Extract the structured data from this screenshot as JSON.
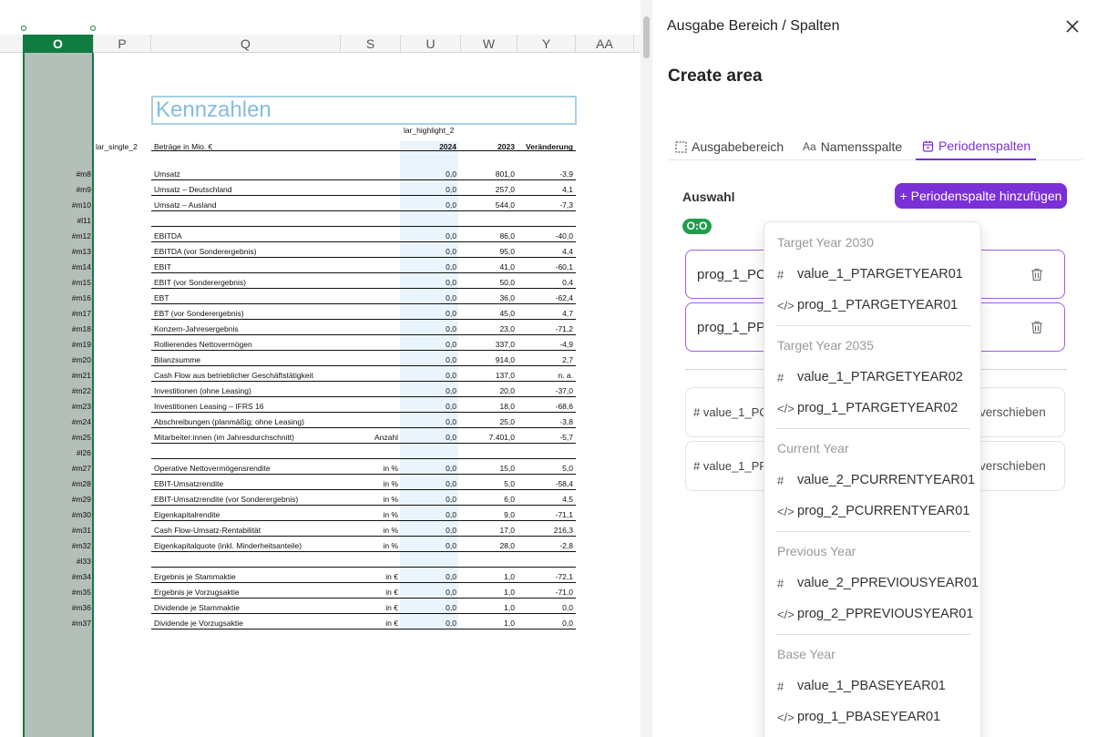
{
  "sheet": {
    "columns": [
      {
        "label": "O",
        "selected": true
      },
      {
        "label": "P"
      },
      {
        "label": "Q"
      },
      {
        "label": "S"
      },
      {
        "label": "U"
      },
      {
        "label": "W"
      },
      {
        "label": "Y"
      },
      {
        "label": "AA"
      }
    ],
    "title": "Kennzahlen",
    "highlight_label": "lar_highlight_2",
    "single_label": "lar_single_2",
    "amounts_label": "Beträge in Mio. €",
    "col_2024": "2024",
    "col_2023": "2023",
    "col_change": "Veränderung",
    "rows": [
      {
        "code": "#m8",
        "label": "Umsatz",
        "unit": "",
        "v2024": "0,0",
        "v2023": "801,0",
        "change": "-3,9"
      },
      {
        "code": "#m9",
        "label": "Umsatz – Deutschland",
        "unit": "",
        "v2024": "0,0",
        "v2023": "257,0",
        "change": "4,1"
      },
      {
        "code": "#m10",
        "label": "Umsatz – Ausland",
        "unit": "",
        "v2024": "0,0",
        "v2023": "544,0",
        "change": "-7,3"
      },
      {
        "code": "#l11",
        "label": "",
        "unit": "",
        "v2024": "",
        "v2023": "",
        "change": ""
      },
      {
        "code": "#m12",
        "label": "EBITDA",
        "unit": "",
        "v2024": "0,0",
        "v2023": "86,0",
        "change": "-40,0"
      },
      {
        "code": "#m13",
        "label": "EBITDA (vor Sonderergebnis)",
        "unit": "",
        "v2024": "0,0",
        "v2023": "95,0",
        "change": "4,4"
      },
      {
        "code": "#m14",
        "label": "EBIT",
        "unit": "",
        "v2024": "0,0",
        "v2023": "41,0",
        "change": "-60,1"
      },
      {
        "code": "#m15",
        "label": "EBIT (vor Sonderergebnis)",
        "unit": "",
        "v2024": "0,0",
        "v2023": "50,0",
        "change": "0,4"
      },
      {
        "code": "#m16",
        "label": "EBT",
        "unit": "",
        "v2024": "0,0",
        "v2023": "36,0",
        "change": "-62,4"
      },
      {
        "code": "#m17",
        "label": "EBT (vor Sonderergebnis)",
        "unit": "",
        "v2024": "0,0",
        "v2023": "45,0",
        "change": "4,7"
      },
      {
        "code": "#m18",
        "label": "Konzern-Jahresergebnis",
        "unit": "",
        "v2024": "0,0",
        "v2023": "23,0",
        "change": "-71,2"
      },
      {
        "code": "#m19",
        "label": "Rollierendes Nettovermögen",
        "unit": "",
        "v2024": "0,0",
        "v2023": "337,0",
        "change": "-4,9"
      },
      {
        "code": "#m20",
        "label": "Bilanzsumme",
        "unit": "",
        "v2024": "0,0",
        "v2023": "914,0",
        "change": "2,7"
      },
      {
        "code": "#m21",
        "label": "Cash Flow aus betrieblicher Geschäftstätigkeit",
        "unit": "",
        "v2024": "0,0",
        "v2023": "137,0",
        "change": "n. a."
      },
      {
        "code": "#m22",
        "label": "Investitionen (ohne Leasing)",
        "unit": "",
        "v2024": "0,0",
        "v2023": "20,0",
        "change": "-37,0"
      },
      {
        "code": "#m23",
        "label": "Investitionen Leasing – IFRS 16",
        "unit": "",
        "v2024": "0,0",
        "v2023": "18,0",
        "change": "-68,6"
      },
      {
        "code": "#m24",
        "label": "Abschreibungen (planmäßig; ohne Leasing)",
        "unit": "",
        "v2024": "0,0",
        "v2023": "25,0",
        "change": "-3,8"
      },
      {
        "code": "#m25",
        "label": "Mitarbeiter:innen (im Jahresdurchschnitt)",
        "unit": "Anzahl",
        "v2024": "0,0",
        "v2023": "7.401,0",
        "change": "-5,7"
      },
      {
        "code": "#l26",
        "label": "",
        "unit": "",
        "v2024": "",
        "v2023": "",
        "change": ""
      },
      {
        "code": "#m27",
        "label": "Operative Nettovermögensrendite",
        "unit": "in %",
        "v2024": "0,0",
        "v2023": "15,0",
        "change": "5,0"
      },
      {
        "code": "#m28",
        "label": "EBIT-Umsatzrendite",
        "unit": "in %",
        "v2024": "0,0",
        "v2023": "5,0",
        "change": "-58,4"
      },
      {
        "code": "#m29",
        "label": "EBIT-Umsatzrendite (vor Sonderergebnis)",
        "unit": "in %",
        "v2024": "0,0",
        "v2023": "6,0",
        "change": "4,5"
      },
      {
        "code": "#m30",
        "label": "Eigenkapitalrendite",
        "unit": "in %",
        "v2024": "0,0",
        "v2023": "9,0",
        "change": "-71,1"
      },
      {
        "code": "#m31",
        "label": "Cash Flow-Umsatz-Rentabilität",
        "unit": "in %",
        "v2024": "0,0",
        "v2023": "17,0",
        "change": "216,3"
      },
      {
        "code": "#m32",
        "label": "Eigenkapitalquote (inkl. Minderheitsanteile)",
        "unit": "in %",
        "v2024": "0,0",
        "v2023": "28,0",
        "change": "-2,8"
      },
      {
        "code": "#l33",
        "label": "",
        "unit": "",
        "v2024": "",
        "v2023": "",
        "change": ""
      },
      {
        "code": "#m34",
        "label": "Ergebnis je Stammaktie",
        "unit": "in €",
        "v2024": "0,0",
        "v2023": "1,0",
        "change": "-72,1"
      },
      {
        "code": "#m35",
        "label": "Ergebnis je Vorzugsaktie",
        "unit": "in €",
        "v2024": "0,0",
        "v2023": "1,0",
        "change": "-71,0"
      },
      {
        "code": "#m36",
        "label": "Dividende je Stammaktie",
        "unit": "in €",
        "v2024": "0,0",
        "v2023": "1,0",
        "change": "0,0"
      },
      {
        "code": "#m37",
        "label": "Dividende je Vorzugsaktie",
        "unit": "in €",
        "v2024": "0,0",
        "v2023": "1,0",
        "change": "0,0"
      }
    ]
  },
  "panel": {
    "title": "Ausgabe Bereich / Spalten",
    "close_icon": "close-icon",
    "heading": "Create area",
    "tabs": [
      {
        "label": "Ausgabebereich",
        "icon": "dashed-square-icon",
        "active": false
      },
      {
        "label": "Namensspalte",
        "icon": "text-aa-icon",
        "active": false
      },
      {
        "label": "Periodenspalten",
        "icon": "calendar-icon",
        "active": true
      }
    ],
    "auswahl_label": "Auswahl",
    "add_button": "+ Periodenspalte hinzufügen",
    "badge": "O:O",
    "selected_items": [
      {
        "text": "prog_1_PCU"
      },
      {
        "text": "prog_1_PPR"
      }
    ],
    "available_items": [
      {
        "text": "# value_1_PC",
        "move_label": "verschieben"
      },
      {
        "text": "# value_1_PP",
        "move_label": "verschieben"
      }
    ]
  },
  "dropdown": {
    "groups": [
      {
        "title": "Target Year 2030",
        "options": [
          {
            "icon": "#",
            "label": "value_1_PTARGETYEAR01"
          },
          {
            "icon": "</>",
            "label": "prog_1_PTARGETYEAR01"
          }
        ]
      },
      {
        "title": "Target Year 2035",
        "options": [
          {
            "icon": "#",
            "label": "value_1_PTARGETYEAR02"
          },
          {
            "icon": "</>",
            "label": "prog_1_PTARGETYEAR02"
          }
        ]
      },
      {
        "title": "Current Year",
        "options": [
          {
            "icon": "#",
            "label": "value_2_PCURRENTYEAR01"
          },
          {
            "icon": "</>",
            "label": "prog_2_PCURRENTYEAR01"
          }
        ]
      },
      {
        "title": "Previous Year",
        "options": [
          {
            "icon": "#",
            "label": "value_2_PPREVIOUSYEAR01"
          },
          {
            "icon": "</>",
            "label": "prog_2_PPREVIOUSYEAR01"
          }
        ]
      },
      {
        "title": "Base Year",
        "options": [
          {
            "icon": "#",
            "label": "value_1_PBASEYEAR01"
          },
          {
            "icon": "</>",
            "label": "prog_1_PBASEYEAR01"
          }
        ]
      }
    ]
  },
  "colors": {
    "accent": "#7b2fd6",
    "excel_green": "#107c41",
    "badge_green": "#1f9d4d",
    "highlight_blue": "#eaf4fc"
  }
}
